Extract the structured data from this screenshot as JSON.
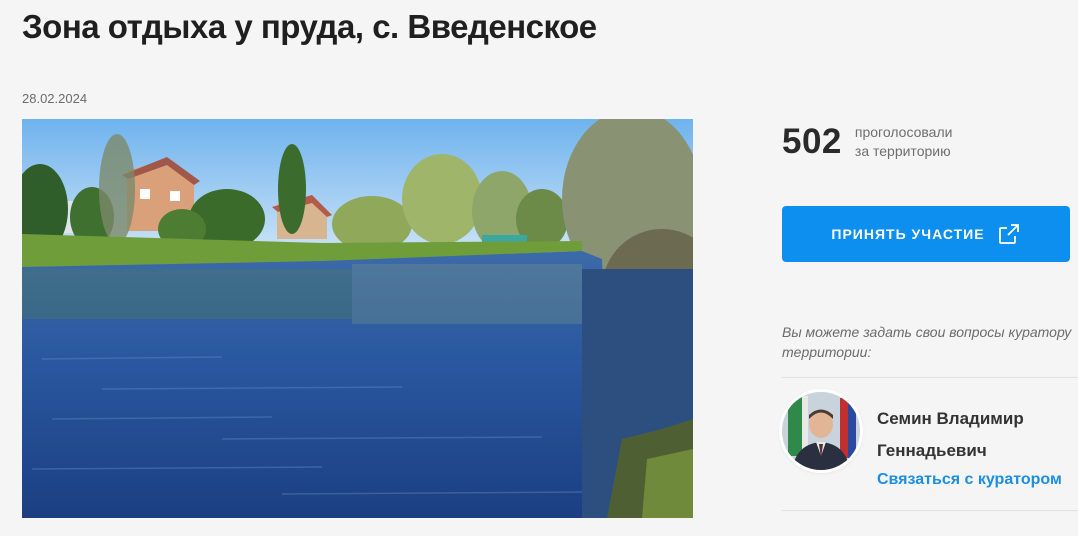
{
  "page": {
    "title": "Зона отдыха у пруда, с. Введенское",
    "date": "28.02.2024"
  },
  "photo": {
    "icon": "pond-photo"
  },
  "votes": {
    "count": "502",
    "label_line1": "проголосовали",
    "label_line2": "за территорию"
  },
  "cta": {
    "label": "ПРИНЯТЬ УЧАСТИЕ",
    "icon": "external-link-icon",
    "color": "#0d8ff0"
  },
  "curator": {
    "hint_line1": "Вы можете задать свои вопросы куратору",
    "hint_line2": "территории:",
    "name_line1": "Семин Владимир",
    "name_line2": "Геннадьевич",
    "contact_link": "Связаться с куратором",
    "link_color": "#1b8ee6"
  }
}
